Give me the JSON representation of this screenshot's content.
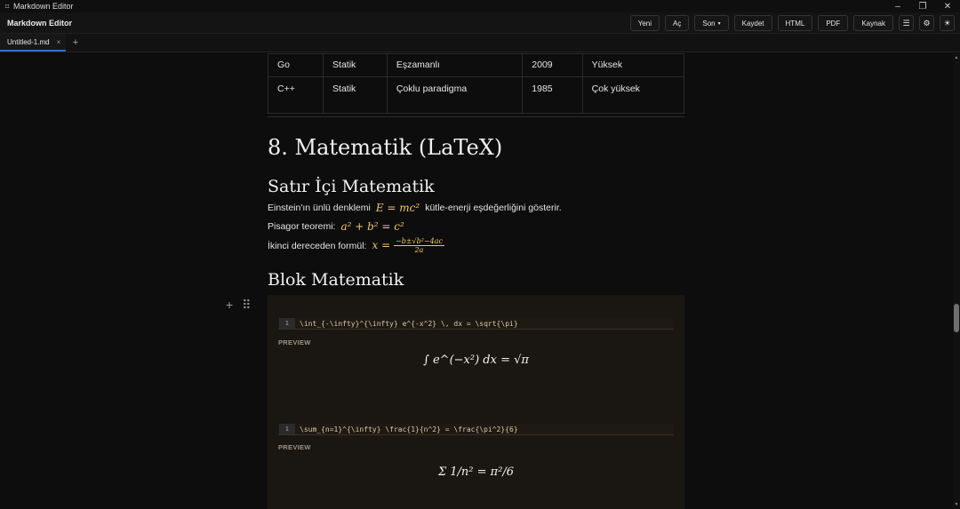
{
  "window": {
    "title": "Markdown Editor",
    "app_icon": "markdown-icon"
  },
  "toolbar": {
    "brand": "Markdown Editor",
    "buttons": {
      "new": "Yeni",
      "open": "Aç",
      "recent": "Son",
      "save": "Kaydet",
      "html": "HTML",
      "pdf": "PDF",
      "source": "Kaynak"
    }
  },
  "tabs": [
    {
      "label": "Untitled-1.md"
    }
  ],
  "table": {
    "rows": [
      [
        "Go",
        "Statik",
        "Eşzamanlı",
        "2009",
        "Yüksek"
      ],
      [
        "C++",
        "Statik",
        "Çoklu paradigma",
        "1985",
        "Çok yüksek"
      ]
    ]
  },
  "doc": {
    "h1": "8. Matematik (LaTeX)",
    "inline_heading": "Satır İçi Matematik",
    "p1_before": "Einstein'ın ünlü denklemi",
    "p1_math": "E = mc²",
    "p1_after": "kütle-enerji eşdeğerliğini gösterir.",
    "p2_before": "Pisagor teoremi:",
    "p2_math": "a² + b² = c²",
    "p3_before": "İkinci dereceden formül:",
    "p3_lhs": "x =",
    "p3_num": "−b±√b²−4ac",
    "p3_den": "2a",
    "block_heading": "Blok Matematik",
    "blocks": [
      {
        "line": "1",
        "code": "\\int_{-\\infty}^{\\infty} e^{-x^2} \\, dx = \\sqrt{\\pi}",
        "preview_label": "PREVIEW",
        "preview": "∫ e^(−x²) dx = √π"
      },
      {
        "line": "1",
        "code": "\\sum_{n=1}^{\\infty} \\frac{1}{n^2} = \\frac{\\pi^2}{6}",
        "preview_label": "PREVIEW",
        "preview": "Σ 1/n² = π²/6"
      }
    ]
  },
  "colors": {
    "accent": "#2b6fd6",
    "math": "#f2c46e",
    "block_bg": "#1a1611"
  }
}
